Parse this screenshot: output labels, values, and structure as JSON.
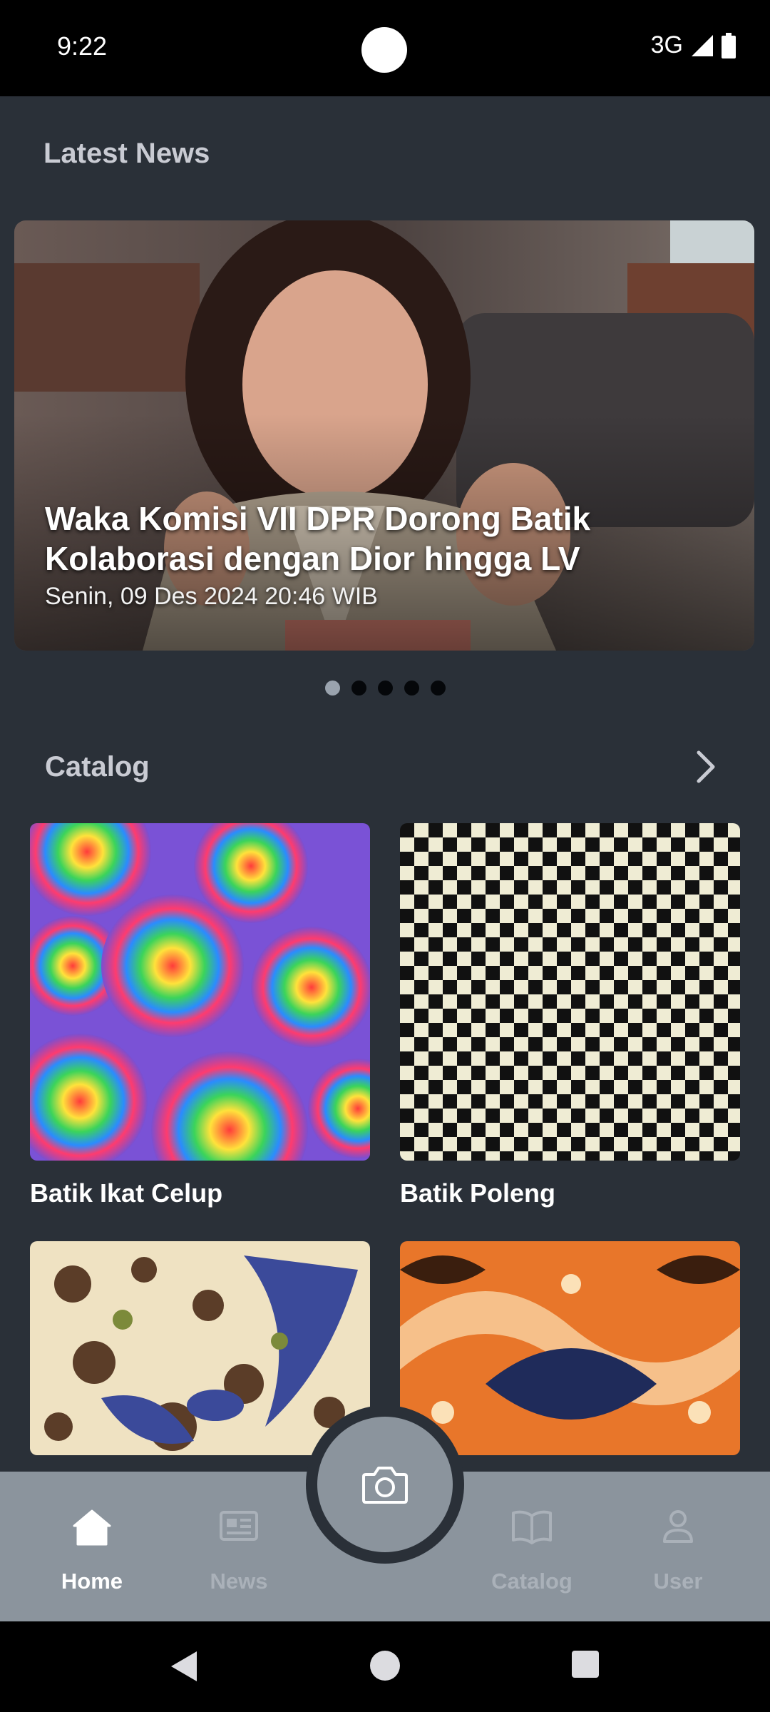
{
  "status_bar": {
    "time": "9:22",
    "network": "3G"
  },
  "news": {
    "section_title": "Latest News",
    "headline": "Waka Komisi VII DPR Dorong Batik Kolaborasi dengan Dior hingga LV",
    "date": "Senin, 09 Des 2024 20:46 WIB",
    "carousel": {
      "count": 5,
      "active_index": 0
    }
  },
  "catalog": {
    "section_title": "Catalog",
    "items": [
      {
        "label": "Batik Ikat Celup"
      },
      {
        "label": "Batik Poleng"
      },
      {
        "label": ""
      },
      {
        "label": ""
      }
    ]
  },
  "bottom_nav": {
    "items": [
      {
        "label": "Home",
        "icon": "home-icon",
        "active": true
      },
      {
        "label": "News",
        "icon": "newspaper-icon",
        "active": false
      },
      {
        "label": "Catalog",
        "icon": "book-icon",
        "active": false
      },
      {
        "label": "User",
        "icon": "user-icon",
        "active": false
      }
    ],
    "center_button_icon": "camera-icon"
  },
  "colors": {
    "background": "#2a3038",
    "nav_background": "#8b949d",
    "active_label": "#ffffff",
    "inactive_label": "#aab1b9"
  }
}
